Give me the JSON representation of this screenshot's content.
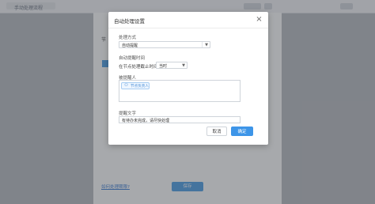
{
  "background": {
    "tab_label": "手动处理流程",
    "side_label": "节",
    "link_text": "如何处理期限?",
    "save_label": "保存"
  },
  "modal": {
    "title": "自动处理设置",
    "close_glyph": "×",
    "method_label": "处理方式",
    "method_value": "自动提醒",
    "time_label": "自动提醒时间",
    "time_prefix": "在节点处理截止时间",
    "time_value": "当时",
    "recipients_label": "被提醒人",
    "recipient_tag": "节点负责人",
    "message_label": "提醒文字",
    "message_value": "有待办未完成，请尽快处理",
    "cancel_label": "取消",
    "ok_label": "确定"
  },
  "colors": {
    "primary": "#3d95e8",
    "tag_text": "#4d8fd6",
    "overlay": "rgba(60,64,72,0.45)"
  }
}
